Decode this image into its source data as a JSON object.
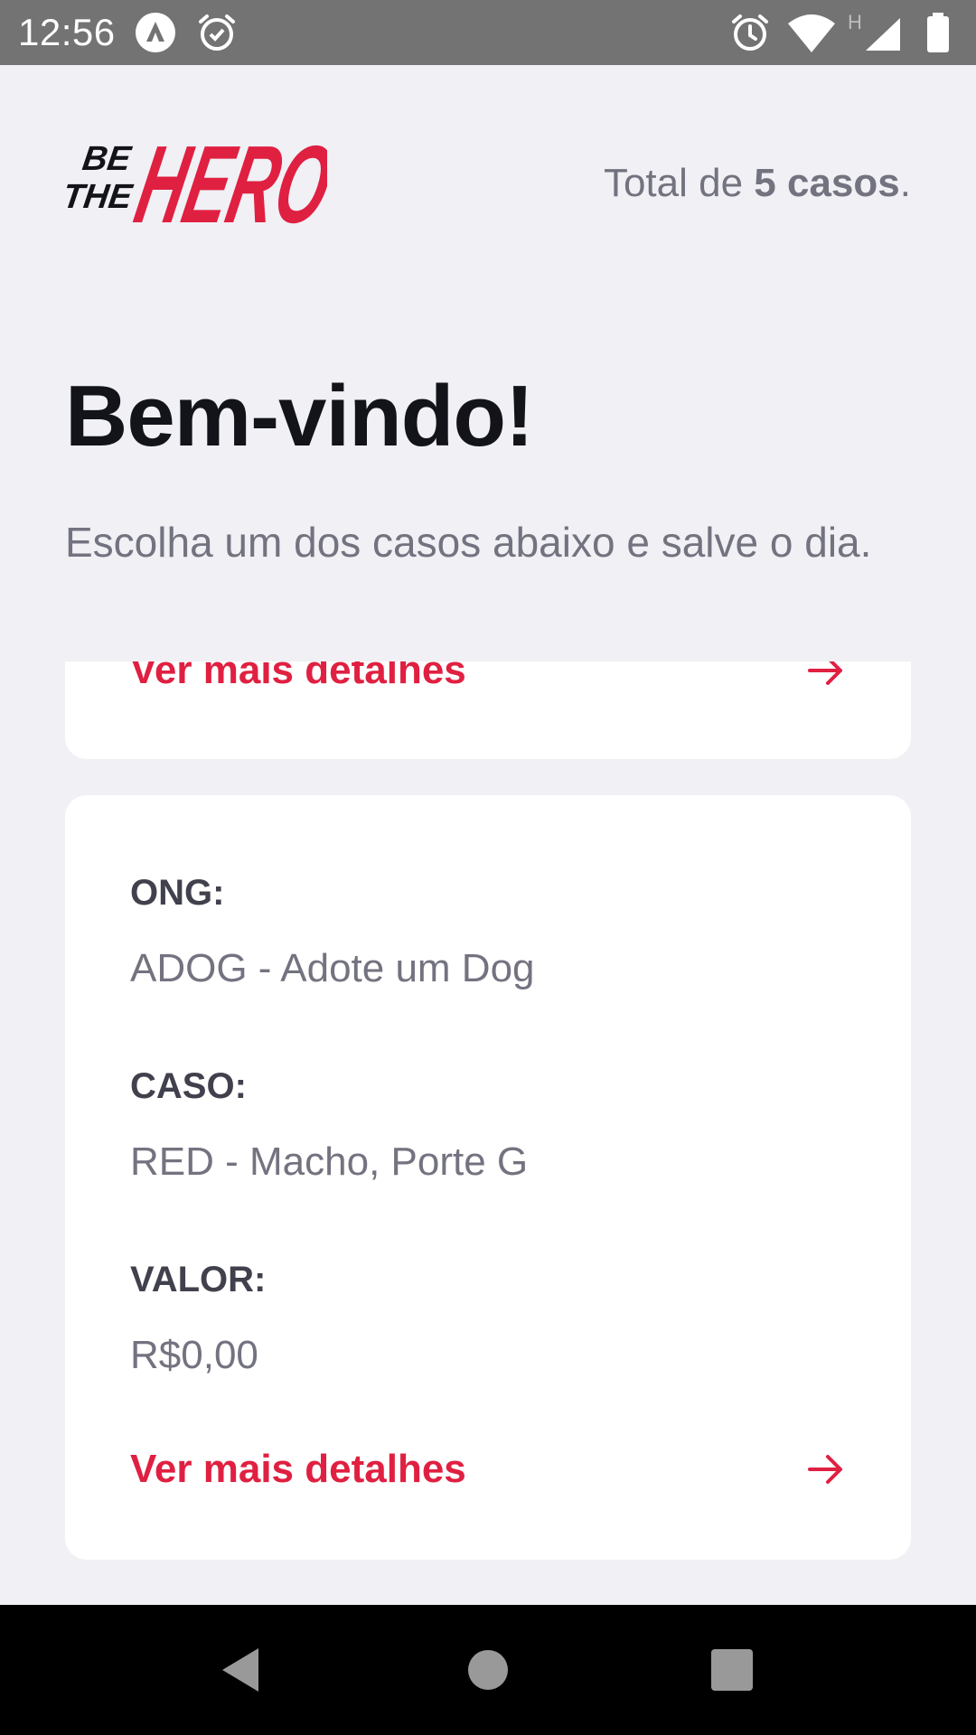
{
  "status_bar": {
    "time": "12:56",
    "left_icons": [
      "app-notification-icon",
      "alarm-check-icon"
    ],
    "right_icons": [
      "alarm-icon",
      "wifi-icon",
      "signal-h-icon",
      "battery-icon"
    ],
    "signal_label": "H",
    "background": "#737373"
  },
  "header": {
    "logo_line1": "BE",
    "logo_line2": "THE",
    "logo_hero": "HERO",
    "total_prefix": "Total de ",
    "total_count": "5 casos",
    "total_suffix": "."
  },
  "title": "Bem-vindo!",
  "description": "Escolha um dos casos abaixo e salve o dia.",
  "incidents": [
    {
      "partial": true,
      "details_label": "Ver mais detalhes"
    },
    {
      "ong_label": "ONG:",
      "ong_value": "ADOG - Adote um Dog",
      "caso_label": "CASO:",
      "caso_value": "RED - Macho, Porte G",
      "valor_label": "VALOR:",
      "valor_value": "R$0,00",
      "details_label": "Ver mais detalhes"
    }
  ],
  "nav_bar": {
    "buttons": [
      "back-icon",
      "home-icon",
      "recents-icon"
    ]
  },
  "colors": {
    "accent": "#e02041",
    "background": "#f0f0f5",
    "card": "#ffffff",
    "title": "#13131a",
    "label": "#41414d",
    "muted": "#737380"
  }
}
